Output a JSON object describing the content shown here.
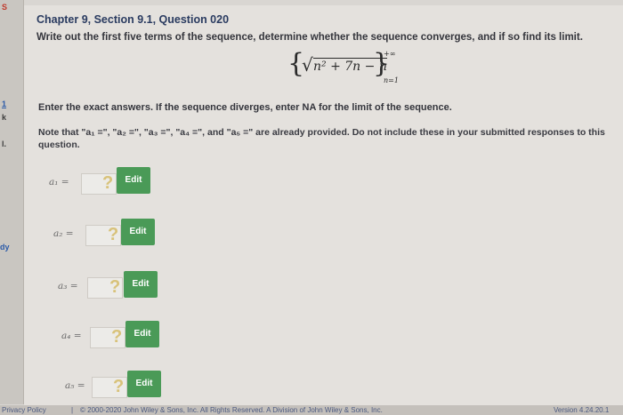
{
  "sidebar": {
    "top_glyph": "S",
    "mid_glyph_1": "1",
    "mid_glyph_2": "k",
    "mid_glyph_3": "l.",
    "link_text": "dy"
  },
  "question": {
    "title": "Chapter 9, Section 9.1, Question 020",
    "instruction": "Write out the first five terms of the sequence, determine whether the sequence converges, and if so find its limit.",
    "formula": {
      "open_brace": "{",
      "close_brace": "}",
      "sqrt_symbol": "√",
      "sqrt_body": "n² + 7n − n",
      "upper_limit": "+∞",
      "lower_limit": "n=1"
    },
    "exact_answers": "Enter the exact answers. If the sequence diverges, enter NA for the limit of the sequence.",
    "note": "Note that \"a₁ =\", \"a₂ =\", \"a₃ =\", \"a₄ =\", and \"a₅ =\" are already provided. Do not include these in your submitted responses to this question."
  },
  "answers": [
    {
      "label": "a₁ =",
      "placeholder": "?",
      "button": "Edit"
    },
    {
      "label": "a₂ =",
      "placeholder": "?",
      "button": "Edit"
    },
    {
      "label": "a₃ =",
      "placeholder": "?",
      "button": "Edit"
    },
    {
      "label": "a₄ =",
      "placeholder": "?",
      "button": "Edit"
    },
    {
      "label": "a₅ =",
      "placeholder": "?",
      "button": "Edit"
    }
  ],
  "footer": {
    "privacy": "Privacy Policy",
    "separator": "|",
    "copyright": "© 2000-2020 John Wiley & Sons, Inc. All Rights Reserved. A Division of John Wiley & Sons, Inc.",
    "version": "Version 4.24.20.1"
  },
  "colors": {
    "edit_button": "#4a9a57",
    "title": "#2a3b60",
    "link": "#2b5aa8"
  }
}
